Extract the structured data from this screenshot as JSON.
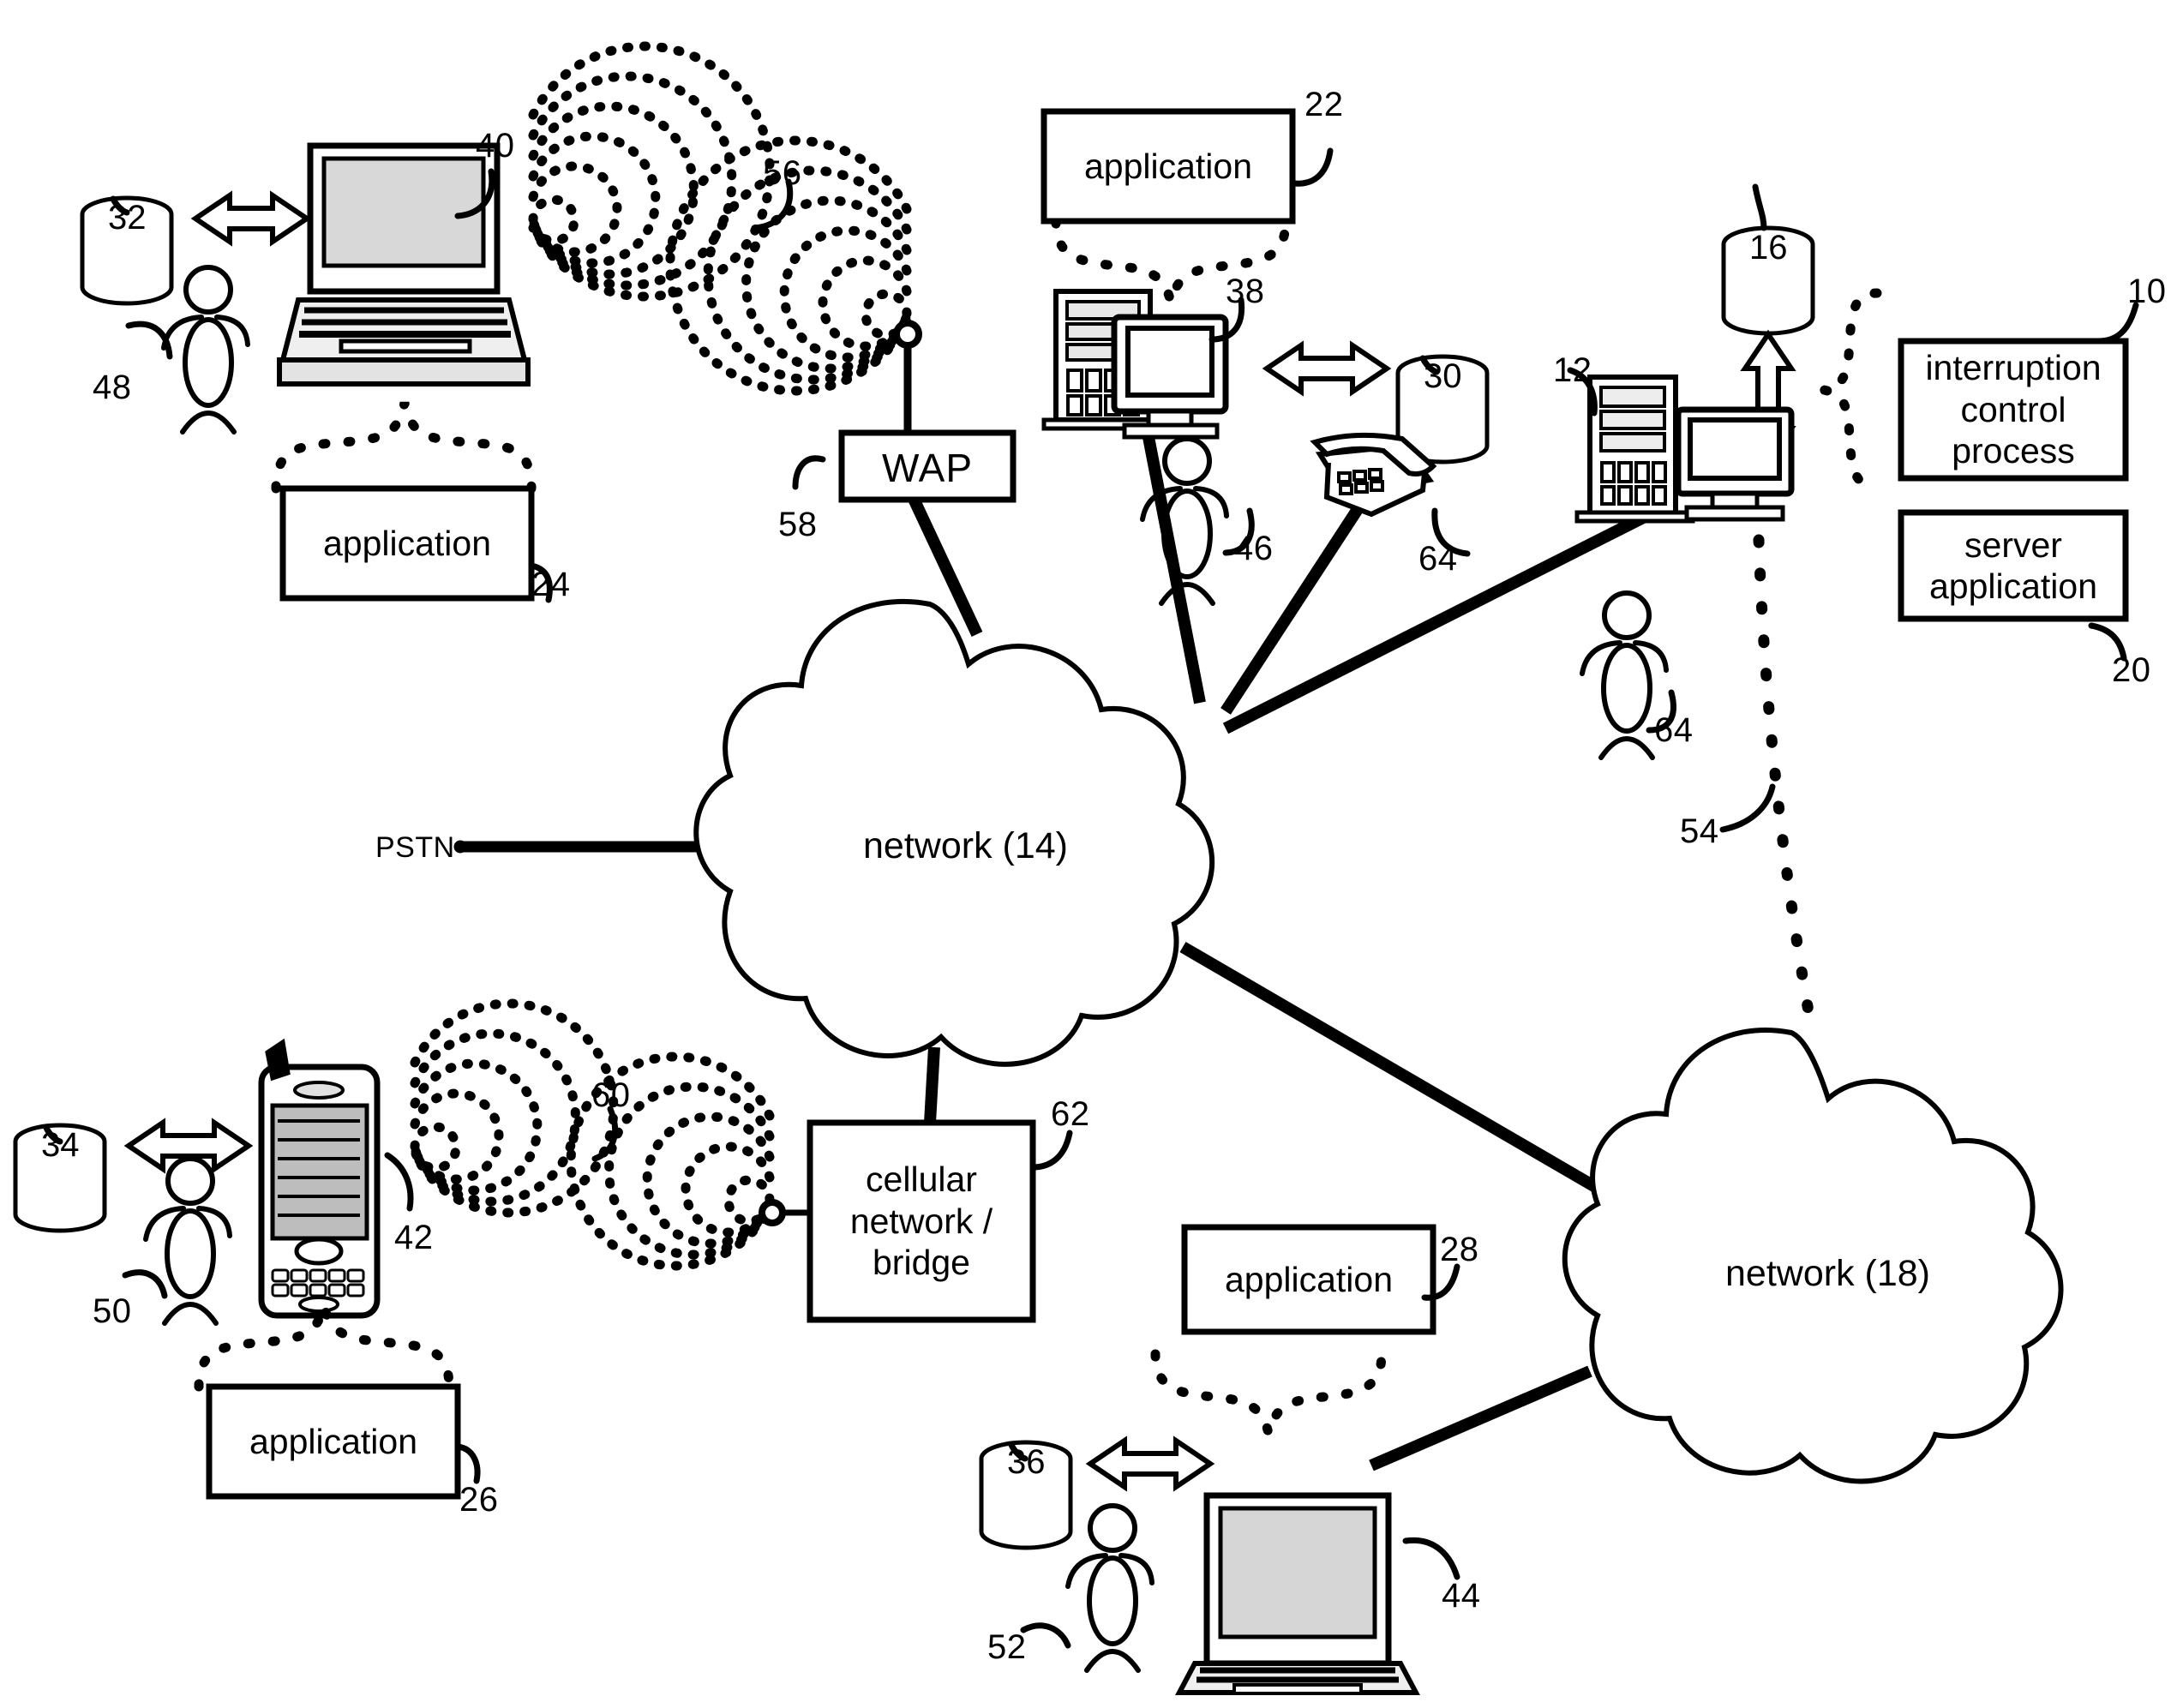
{
  "figure": {
    "type": "patent-network-diagram",
    "title": "",
    "background": "#ffffff",
    "stroke": "#000000"
  },
  "boxes": [
    {
      "id": "app22",
      "label": "application",
      "ref": "22"
    },
    {
      "id": "app24",
      "label": "application",
      "ref": "24"
    },
    {
      "id": "app26",
      "label": "application",
      "ref": "26"
    },
    {
      "id": "app28",
      "label": "application",
      "ref": "28"
    },
    {
      "id": "icp10",
      "label": "interruption\ncontrol\nprocess",
      "ref": "10"
    },
    {
      "id": "srvapp20",
      "label": "server\napplication",
      "ref": "20"
    },
    {
      "id": "wap58",
      "label": "WAP",
      "ref": "58"
    },
    {
      "id": "cell62",
      "label": "cellular\nnetwork /\nbridge",
      "ref": "62"
    }
  ],
  "box_text": {
    "application": "application",
    "interruption_control_process": "interruption control process",
    "icp_line1": "interruption",
    "icp_line2": "control",
    "icp_line3": "process",
    "server_application_line1": "server",
    "server_application_line2": "application",
    "wap": "WAP",
    "cell_line1": "cellular",
    "cell_line2": "network /",
    "cell_line3": "bridge"
  },
  "clouds": [
    {
      "id": "network14",
      "label": "network (14)"
    },
    {
      "id": "network18",
      "label": "network (18)"
    }
  ],
  "databases": [
    {
      "id": "db32",
      "number": "32"
    },
    {
      "id": "db30",
      "number": "30"
    },
    {
      "id": "db16",
      "number": "16"
    },
    {
      "id": "db34",
      "number": "34"
    },
    {
      "id": "db36",
      "number": "36"
    }
  ],
  "devices": [
    {
      "id": "laptop40",
      "kind": "laptop",
      "ref": "40"
    },
    {
      "id": "desktop38",
      "kind": "desktop-tower",
      "ref": "38"
    },
    {
      "id": "server12",
      "kind": "server-tower",
      "ref": "12"
    },
    {
      "id": "phone42",
      "kind": "smartphone",
      "ref": "42"
    },
    {
      "id": "laptop44",
      "kind": "laptop",
      "ref": "44"
    },
    {
      "id": "telephone64",
      "kind": "desk-phone",
      "ref": "64"
    }
  ],
  "users": [
    {
      "id": "user48",
      "ref": "48"
    },
    {
      "id": "user46",
      "ref": "46"
    },
    {
      "id": "user64",
      "ref": "64"
    },
    {
      "id": "user50",
      "ref": "50"
    },
    {
      "id": "user52",
      "ref": "52"
    }
  ],
  "wireless": [
    {
      "id": "wifi-laptop40",
      "ref": "",
      "direction": "right"
    },
    {
      "id": "wifi-wap56",
      "ref": "56",
      "direction": "left"
    },
    {
      "id": "wifi-phone42",
      "ref": "",
      "direction": "right"
    },
    {
      "id": "wifi-cell60",
      "ref": "60",
      "direction": "left"
    }
  ],
  "ref_numbers": {
    "n10": "10",
    "n12": "12",
    "n16": "16",
    "n20": "20",
    "n22": "22",
    "n24": "24",
    "n26": "26",
    "n28": "28",
    "n30": "30",
    "n32": "32",
    "n34": "34",
    "n36": "36",
    "n38": "38",
    "n40": "40",
    "n42": "42",
    "n44": "44",
    "n46": "46",
    "n48": "48",
    "n50": "50",
    "n52": "52",
    "n54": "54",
    "n56": "56",
    "n58": "58",
    "n60": "60",
    "n62": "62",
    "n64a": "64",
    "n64b": "64"
  },
  "labels": {
    "pstn": "PSTN",
    "network14": "network (14)",
    "network18": "network (18)"
  },
  "connections": [
    {
      "from": "pstn",
      "to": "network14",
      "style": "solid-thick"
    },
    {
      "from": "wap58",
      "to": "network14",
      "style": "solid-thick"
    },
    {
      "from": "desktop38",
      "to": "network14",
      "style": "solid-thick"
    },
    {
      "from": "telephone64",
      "to": "network14",
      "style": "solid-thick"
    },
    {
      "from": "server12",
      "to": "network14",
      "style": "solid-thick"
    },
    {
      "from": "network14",
      "to": "cell62",
      "style": "solid-thick"
    },
    {
      "from": "network14",
      "to": "network18",
      "style": "solid-thick"
    },
    {
      "from": "network18",
      "to": "laptop44",
      "style": "solid-thick"
    },
    {
      "from": "server12",
      "to": "network18",
      "style": "dotted",
      "ref": "54"
    },
    {
      "from": "db32",
      "to": "laptop40",
      "style": "double-arrow"
    },
    {
      "from": "db30",
      "to": "desktop38",
      "style": "double-arrow"
    },
    {
      "from": "db16",
      "to": "server12",
      "style": "double-arrow"
    },
    {
      "from": "db34",
      "to": "phone42",
      "style": "double-arrow"
    },
    {
      "from": "db36",
      "to": "laptop44",
      "style": "double-arrow"
    }
  ]
}
